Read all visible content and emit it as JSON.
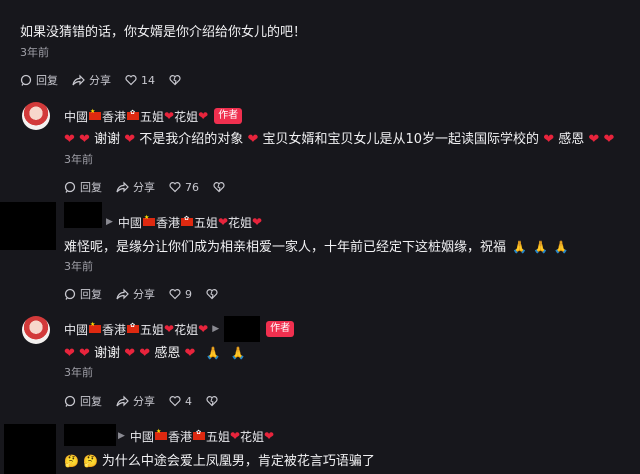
{
  "comments": [
    {
      "text": "如果没猜错的话，你女婿是你介绍给你女儿的吧！",
      "time": "3年前",
      "reply_label": "回复",
      "share_label": "分享",
      "likes": "14"
    },
    {
      "name": "中國",
      "name_mid": "香港",
      "name_five": "五姐",
      "name_flower": "花姐",
      "author_badge": "作者",
      "text_a": "谢谢",
      "text_b": "不是我介绍的对象",
      "text_c": "宝贝女婿和宝贝女儿是从10岁一起读国际学校的",
      "text_d": "感恩",
      "time": "3年前",
      "reply_label": "回复",
      "share_label": "分享",
      "likes": "76"
    },
    {
      "reply_to": "中國",
      "reply_to_mid": "香港",
      "reply_to_five": "五姐",
      "reply_to_flower": "花姐",
      "text": "难怪呢，是缘分让你们成为相亲相爱一家人，十年前已经定下这桩姻缘，祝福",
      "time": "3年前",
      "reply_label": "回复",
      "share_label": "分享",
      "likes": "9"
    },
    {
      "name": "中國",
      "name_mid": "香港",
      "name_five": "五姐",
      "name_flower": "花姐",
      "author_badge": "作者",
      "text_a": "谢谢",
      "text_b": "感恩",
      "time": "3年前",
      "reply_label": "回复",
      "share_label": "分享",
      "likes": "4"
    },
    {
      "reply_to": "中國",
      "reply_to_mid": "香港",
      "reply_to_five": "五姐",
      "reply_to_flower": "花姐",
      "text": "为什么中途会爱上凤凰男，肯定被花言巧语骗了"
    }
  ],
  "colors": {
    "background": "#17171c",
    "heart": "#e8243c",
    "author_badge": "#f0304f"
  }
}
